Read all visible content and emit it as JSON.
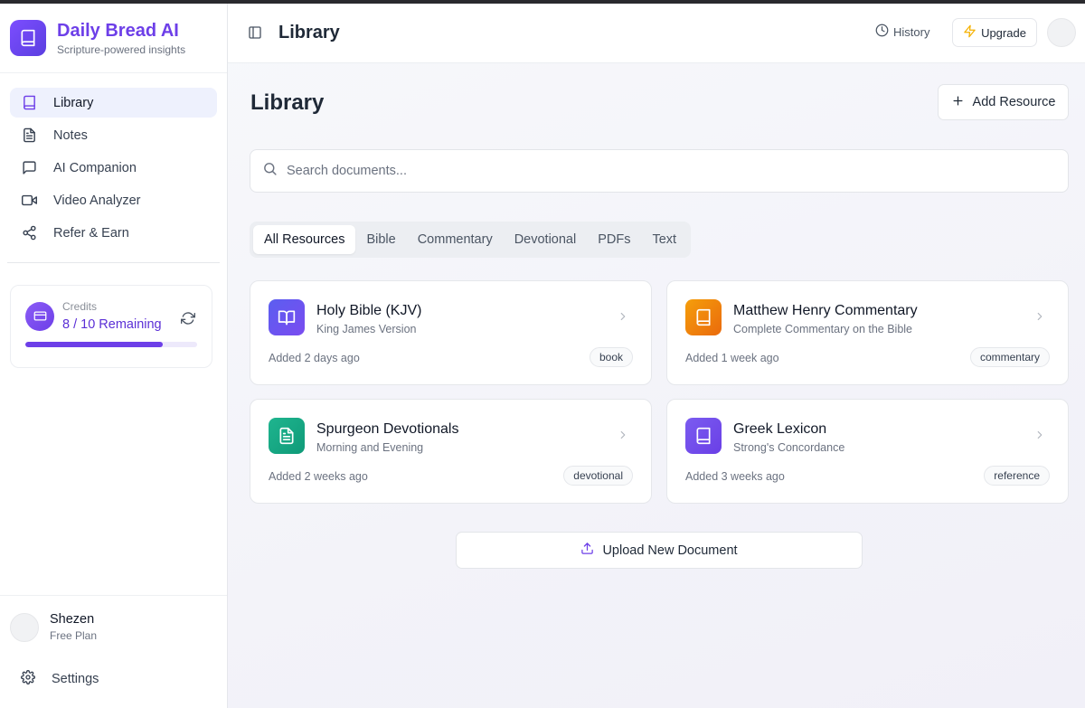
{
  "brand": {
    "title": "Daily Bread AI",
    "subtitle": "Scripture-powered insights",
    "icon": "book-icon"
  },
  "sidebar": {
    "items": [
      {
        "label": "Library",
        "icon": "book-icon",
        "active": true
      },
      {
        "label": "Notes",
        "icon": "file-text-icon",
        "active": false
      },
      {
        "label": "AI Companion",
        "icon": "message-square-icon",
        "active": false
      },
      {
        "label": "Video Analyzer",
        "icon": "video-icon",
        "active": false
      },
      {
        "label": "Refer & Earn",
        "icon": "share-icon",
        "active": false
      }
    ]
  },
  "credits": {
    "label": "Credits",
    "value": "8 / 10 Remaining",
    "used": 8,
    "total": 10,
    "icon": "credit-card-icon"
  },
  "user": {
    "name": "Shezen",
    "plan": "Free Plan"
  },
  "settings": {
    "label": "Settings",
    "icon": "gear-icon"
  },
  "topbar": {
    "title": "Library",
    "history_label": "History",
    "upgrade_label": "Upgrade"
  },
  "main": {
    "title": "Library",
    "add_resource_label": "Add Resource",
    "search": {
      "placeholder": "Search documents...",
      "value": ""
    },
    "tabs": [
      {
        "label": "All Resources",
        "active": true
      },
      {
        "label": "Bible",
        "active": false
      },
      {
        "label": "Commentary",
        "active": false
      },
      {
        "label": "Devotional",
        "active": false
      },
      {
        "label": "PDFs",
        "active": false
      },
      {
        "label": "Text",
        "active": false
      }
    ],
    "cards": [
      {
        "title": "Holy Bible (KJV)",
        "subtitle": "King James Version",
        "added": "Added 2 days ago",
        "tag": "book",
        "icon": "open-book-icon"
      },
      {
        "title": "Matthew Henry Commentary",
        "subtitle": "Complete Commentary on the Bible",
        "added": "Added 1 week ago",
        "tag": "commentary",
        "icon": "book-icon"
      },
      {
        "title": "Spurgeon Devotionals",
        "subtitle": "Morning and Evening",
        "added": "Added 2 weeks ago",
        "tag": "devotional",
        "icon": "file-text-icon"
      },
      {
        "title": "Greek Lexicon",
        "subtitle": "Strong's Concordance",
        "added": "Added 3 weeks ago",
        "tag": "reference",
        "icon": "book-icon"
      }
    ],
    "upload_label": "Upload New Document"
  },
  "colors": {
    "accent": "#6d3fe8",
    "bible_icon": "#5b5ef0",
    "commentary_icon": "#f28c0f",
    "devotional_icon": "#17a784",
    "lexicon_icon": "#7b5cf0",
    "upgrade_bolt": "#f5b100"
  }
}
